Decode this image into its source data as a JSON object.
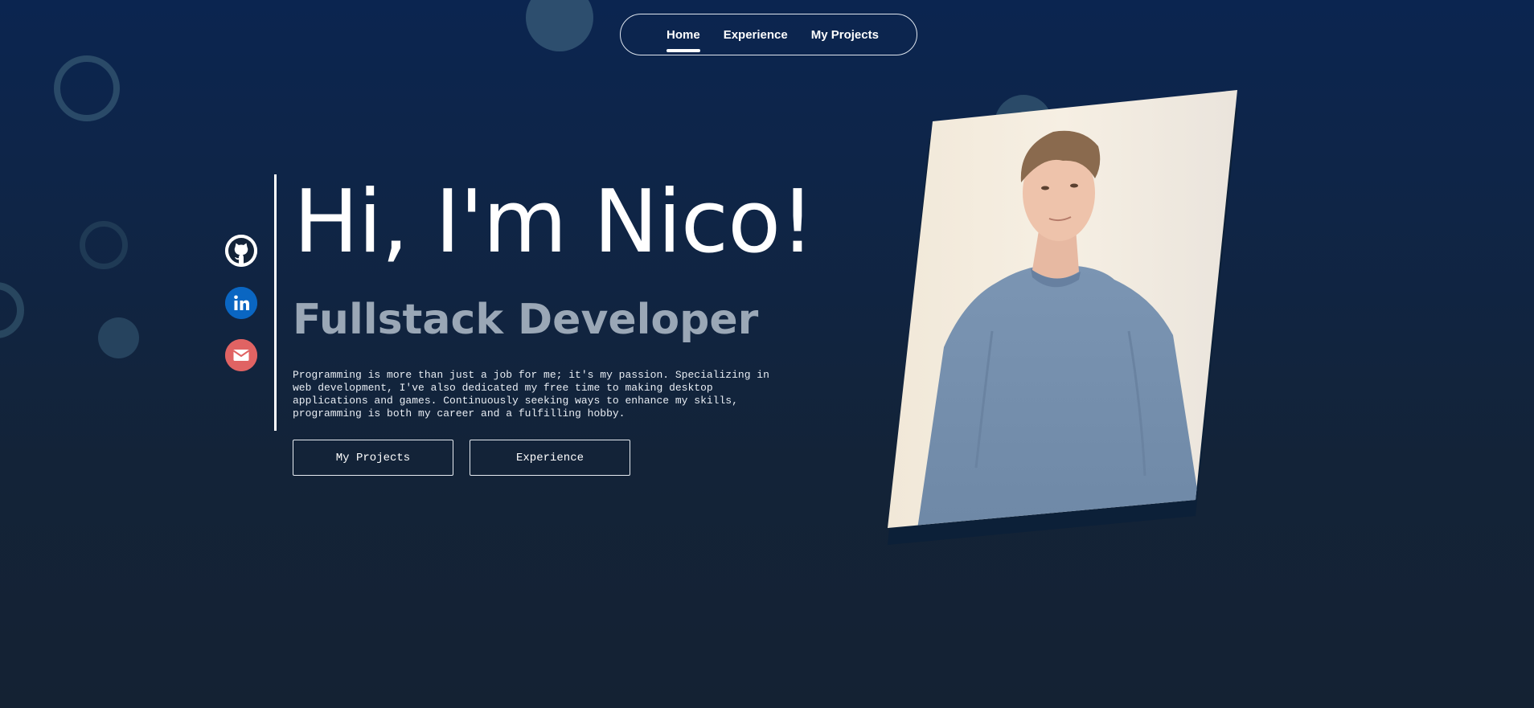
{
  "nav": {
    "items": [
      {
        "label": "Home",
        "active": true
      },
      {
        "label": "Experience",
        "active": false
      },
      {
        "label": "My Projects",
        "active": false
      }
    ]
  },
  "social": {
    "github_icon": "github-icon",
    "linkedin_icon": "linkedin-icon",
    "mail_icon": "mail-icon"
  },
  "hero": {
    "title": "Hi, I'm Nico!",
    "subtitle": "Fullstack Developer",
    "description": "Programming is more than just a job for me; it's my passion. Specializing in web development, I've also dedicated my free time to making desktop applications and games. Continuously seeking ways to enhance my skills, programming is both my career and a fulfilling hobby."
  },
  "buttons": {
    "projects_label": "My Projects",
    "experience_label": "Experience"
  },
  "colors": {
    "background_top": "#0b2550",
    "background_bottom": "#142233",
    "subtitle": "#9aa7b6",
    "linkedin": "#0a66c2",
    "mail": "#e06363"
  }
}
